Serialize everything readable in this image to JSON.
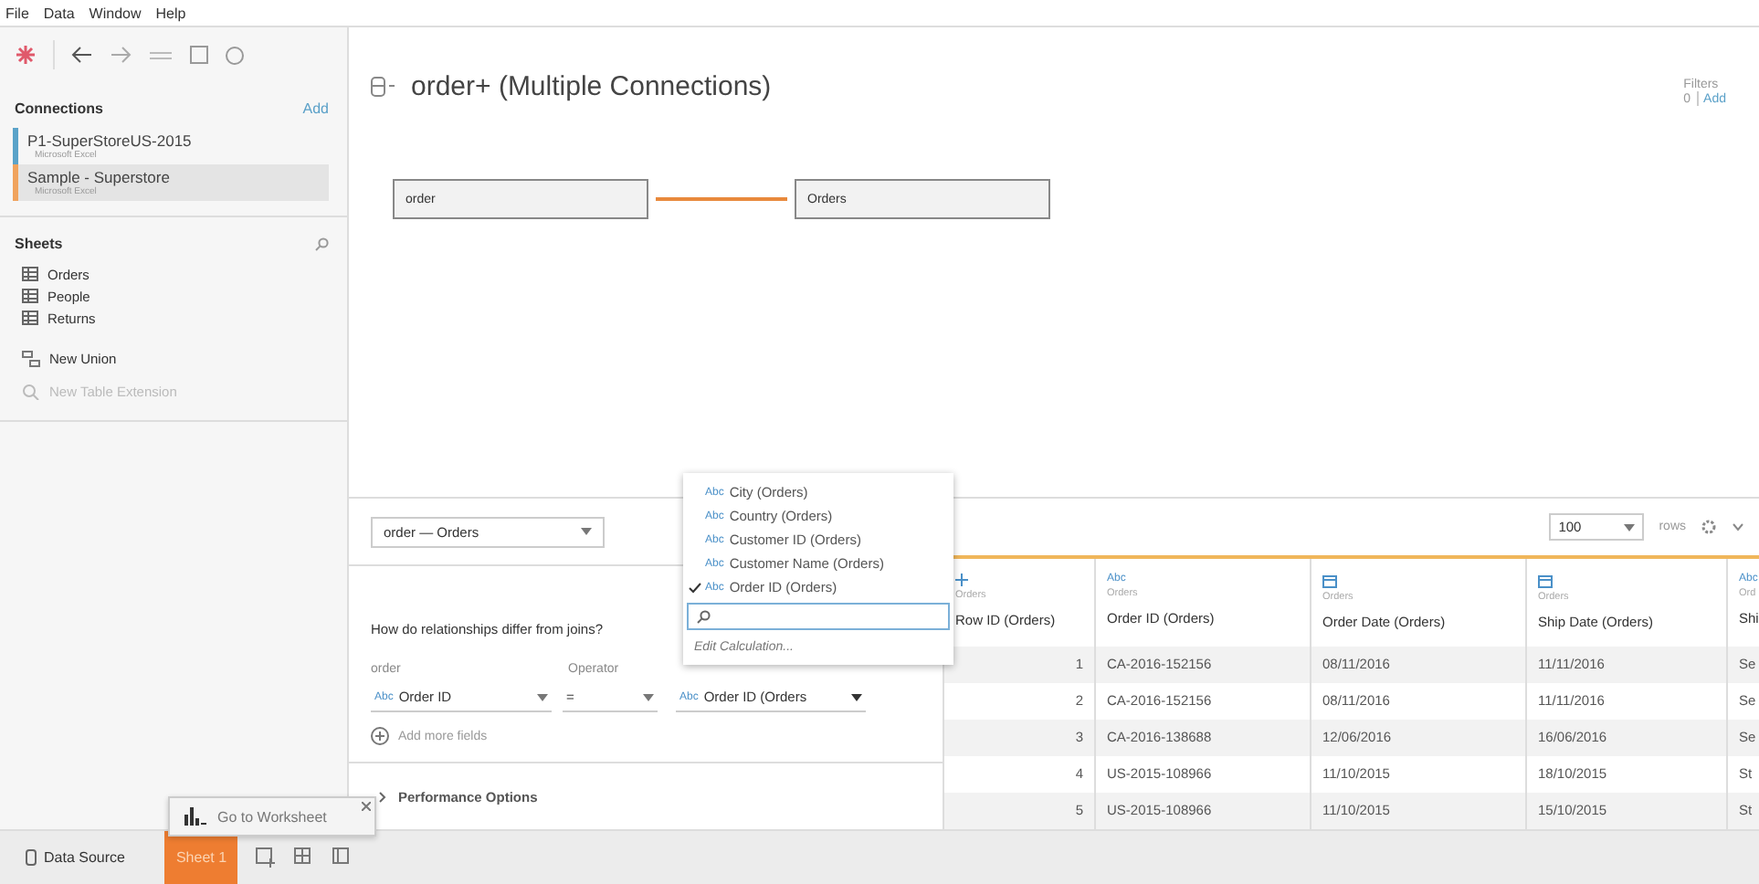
{
  "menu": [
    "File",
    "Data",
    "Window",
    "Help"
  ],
  "connections": {
    "title": "Connections",
    "add": "Add",
    "items": [
      {
        "name": "P1-SuperStoreUS-2015",
        "type": "Microsoft Excel",
        "color": "#5ba3c9",
        "selected": false
      },
      {
        "name": "Sample - Superstore",
        "type": "Microsoft Excel",
        "color": "#f0a35e",
        "selected": true
      }
    ]
  },
  "sheets": {
    "title": "Sheets",
    "items": [
      {
        "name": "Orders",
        "kind": "table",
        "disabled": false
      },
      {
        "name": "People",
        "kind": "table",
        "disabled": false
      },
      {
        "name": "Returns",
        "kind": "table",
        "disabled": false
      },
      {
        "name": "New Union",
        "kind": "union",
        "disabled": false
      },
      {
        "name": "New Table Extension",
        "kind": "extension",
        "disabled": true
      }
    ]
  },
  "canvas": {
    "title": "order+ (Multiple Connections)",
    "filters_label": "Filters",
    "filters_count": "0",
    "filters_add": "Add",
    "tables": [
      "order",
      "Orders"
    ]
  },
  "relationship": {
    "selector": "order — Orders",
    "help": "How do relationships differ from joins?",
    "left_header": "order",
    "operator_header": "Operator",
    "left_type": "Abc",
    "left_field": "Order ID",
    "operator": "=",
    "right_type": "Abc",
    "right_field": "Order ID (Orders",
    "add_fields": "Add more fields",
    "performance": "Performance Options"
  },
  "field_menu": {
    "items": [
      {
        "type": "Abc",
        "label": "City (Orders)",
        "checked": false
      },
      {
        "type": "Abc",
        "label": "Country (Orders)",
        "checked": false
      },
      {
        "type": "Abc",
        "label": "Customer ID (Orders)",
        "checked": false
      },
      {
        "type": "Abc",
        "label": "Customer Name (Orders)",
        "checked": false
      },
      {
        "type": "Abc",
        "label": "Order ID (Orders)",
        "checked": true
      }
    ],
    "edit": "Edit Calculation..."
  },
  "grid": {
    "rows_value": "100",
    "rows_label": "rows",
    "columns": [
      {
        "kind": "number",
        "source": "Orders",
        "name": "Row ID (Orders)"
      },
      {
        "kind": "string",
        "type_label": "Abc",
        "source": "Orders",
        "name": "Order ID (Orders)"
      },
      {
        "kind": "date",
        "source": "Orders",
        "name": "Order Date (Orders)"
      },
      {
        "kind": "date",
        "source": "Orders",
        "name": "Ship Date (Orders)"
      },
      {
        "kind": "string",
        "type_label": "Abc",
        "source": "Ord",
        "name": "Shi"
      }
    ],
    "rows": [
      [
        "1",
        "CA-2016-152156",
        "08/11/2016",
        "11/11/2016",
        "Se"
      ],
      [
        "2",
        "CA-2016-152156",
        "08/11/2016",
        "11/11/2016",
        "Se"
      ],
      [
        "3",
        "CA-2016-138688",
        "12/06/2016",
        "16/06/2016",
        "Se"
      ],
      [
        "4",
        "US-2015-108966",
        "11/10/2015",
        "18/10/2015",
        "St"
      ],
      [
        "5",
        "US-2015-108966",
        "11/10/2015",
        "15/10/2015",
        "St"
      ]
    ]
  },
  "tooltip": {
    "text": "Go to Worksheet"
  },
  "tabs": [
    {
      "label": "Data Source",
      "kind": "source",
      "selected": false
    },
    {
      "label": "Sheet 1",
      "kind": "sheet",
      "selected": true
    }
  ]
}
